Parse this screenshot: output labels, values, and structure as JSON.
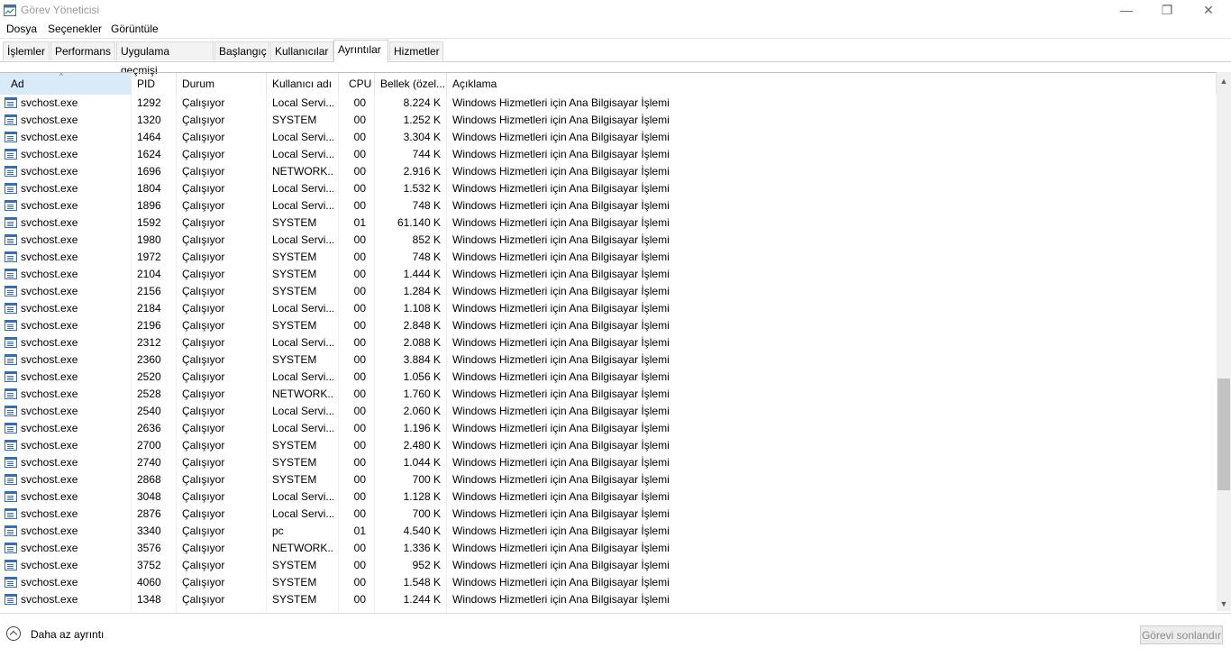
{
  "window": {
    "title": "Görev Yöneticisi",
    "minimize_glyph": "—",
    "maximize_glyph": "❐",
    "close_glyph": "✕"
  },
  "menu": [
    "Dosya",
    "Seçenekler",
    "Görüntüle"
  ],
  "tabs": [
    "İşlemler",
    "Performans",
    "Uygulama geçmişi",
    "Başlangıç",
    "Kullanıcılar",
    "Ayrıntılar",
    "Hizmetler"
  ],
  "active_tab": "Ayrıntılar",
  "columns": {
    "name": "Ad",
    "pid": "PID",
    "status": "Durum",
    "user": "Kullanıcı adı",
    "cpu": "CPU",
    "memory": "Bellek (özel...",
    "description": "Açıklama"
  },
  "sorted_column": "name",
  "sort_glyph": "^",
  "rows": [
    {
      "name": "svchost.exe",
      "pid": "1292",
      "status": "Çalışıyor",
      "user": "Local Servi...",
      "cpu": "00",
      "mem": "8.224 K",
      "desc": "Windows Hizmetleri için Ana Bilgisayar İşlemi"
    },
    {
      "name": "svchost.exe",
      "pid": "1320",
      "status": "Çalışıyor",
      "user": "SYSTEM",
      "cpu": "00",
      "mem": "1.252 K",
      "desc": "Windows Hizmetleri için Ana Bilgisayar İşlemi"
    },
    {
      "name": "svchost.exe",
      "pid": "1464",
      "status": "Çalışıyor",
      "user": "Local Servi...",
      "cpu": "00",
      "mem": "3.304 K",
      "desc": "Windows Hizmetleri için Ana Bilgisayar İşlemi"
    },
    {
      "name": "svchost.exe",
      "pid": "1624",
      "status": "Çalışıyor",
      "user": "Local Servi...",
      "cpu": "00",
      "mem": "744 K",
      "desc": "Windows Hizmetleri için Ana Bilgisayar İşlemi"
    },
    {
      "name": "svchost.exe",
      "pid": "1696",
      "status": "Çalışıyor",
      "user": "NETWORK...",
      "cpu": "00",
      "mem": "2.916 K",
      "desc": "Windows Hizmetleri için Ana Bilgisayar İşlemi"
    },
    {
      "name": "svchost.exe",
      "pid": "1804",
      "status": "Çalışıyor",
      "user": "Local Servi...",
      "cpu": "00",
      "mem": "1.532 K",
      "desc": "Windows Hizmetleri için Ana Bilgisayar İşlemi"
    },
    {
      "name": "svchost.exe",
      "pid": "1896",
      "status": "Çalışıyor",
      "user": "Local Servi...",
      "cpu": "00",
      "mem": "748 K",
      "desc": "Windows Hizmetleri için Ana Bilgisayar İşlemi"
    },
    {
      "name": "svchost.exe",
      "pid": "1592",
      "status": "Çalışıyor",
      "user": "SYSTEM",
      "cpu": "01",
      "mem": "61.140 K",
      "desc": "Windows Hizmetleri için Ana Bilgisayar İşlemi"
    },
    {
      "name": "svchost.exe",
      "pid": "1980",
      "status": "Çalışıyor",
      "user": "Local Servi...",
      "cpu": "00",
      "mem": "852 K",
      "desc": "Windows Hizmetleri için Ana Bilgisayar İşlemi"
    },
    {
      "name": "svchost.exe",
      "pid": "1972",
      "status": "Çalışıyor",
      "user": "SYSTEM",
      "cpu": "00",
      "mem": "748 K",
      "desc": "Windows Hizmetleri için Ana Bilgisayar İşlemi"
    },
    {
      "name": "svchost.exe",
      "pid": "2104",
      "status": "Çalışıyor",
      "user": "SYSTEM",
      "cpu": "00",
      "mem": "1.444 K",
      "desc": "Windows Hizmetleri için Ana Bilgisayar İşlemi"
    },
    {
      "name": "svchost.exe",
      "pid": "2156",
      "status": "Çalışıyor",
      "user": "SYSTEM",
      "cpu": "00",
      "mem": "1.284 K",
      "desc": "Windows Hizmetleri için Ana Bilgisayar İşlemi"
    },
    {
      "name": "svchost.exe",
      "pid": "2184",
      "status": "Çalışıyor",
      "user": "Local Servi...",
      "cpu": "00",
      "mem": "1.108 K",
      "desc": "Windows Hizmetleri için Ana Bilgisayar İşlemi"
    },
    {
      "name": "svchost.exe",
      "pid": "2196",
      "status": "Çalışıyor",
      "user": "SYSTEM",
      "cpu": "00",
      "mem": "2.848 K",
      "desc": "Windows Hizmetleri için Ana Bilgisayar İşlemi"
    },
    {
      "name": "svchost.exe",
      "pid": "2312",
      "status": "Çalışıyor",
      "user": "Local Servi...",
      "cpu": "00",
      "mem": "2.088 K",
      "desc": "Windows Hizmetleri için Ana Bilgisayar İşlemi"
    },
    {
      "name": "svchost.exe",
      "pid": "2360",
      "status": "Çalışıyor",
      "user": "SYSTEM",
      "cpu": "00",
      "mem": "3.884 K",
      "desc": "Windows Hizmetleri için Ana Bilgisayar İşlemi"
    },
    {
      "name": "svchost.exe",
      "pid": "2520",
      "status": "Çalışıyor",
      "user": "Local Servi...",
      "cpu": "00",
      "mem": "1.056 K",
      "desc": "Windows Hizmetleri için Ana Bilgisayar İşlemi"
    },
    {
      "name": "svchost.exe",
      "pid": "2528",
      "status": "Çalışıyor",
      "user": "NETWORK...",
      "cpu": "00",
      "mem": "1.760 K",
      "desc": "Windows Hizmetleri için Ana Bilgisayar İşlemi"
    },
    {
      "name": "svchost.exe",
      "pid": "2540",
      "status": "Çalışıyor",
      "user": "Local Servi...",
      "cpu": "00",
      "mem": "2.060 K",
      "desc": "Windows Hizmetleri için Ana Bilgisayar İşlemi"
    },
    {
      "name": "svchost.exe",
      "pid": "2636",
      "status": "Çalışıyor",
      "user": "Local Servi...",
      "cpu": "00",
      "mem": "1.196 K",
      "desc": "Windows Hizmetleri için Ana Bilgisayar İşlemi"
    },
    {
      "name": "svchost.exe",
      "pid": "2700",
      "status": "Çalışıyor",
      "user": "SYSTEM",
      "cpu": "00",
      "mem": "2.480 K",
      "desc": "Windows Hizmetleri için Ana Bilgisayar İşlemi"
    },
    {
      "name": "svchost.exe",
      "pid": "2740",
      "status": "Çalışıyor",
      "user": "SYSTEM",
      "cpu": "00",
      "mem": "1.044 K",
      "desc": "Windows Hizmetleri için Ana Bilgisayar İşlemi"
    },
    {
      "name": "svchost.exe",
      "pid": "2868",
      "status": "Çalışıyor",
      "user": "SYSTEM",
      "cpu": "00",
      "mem": "700 K",
      "desc": "Windows Hizmetleri için Ana Bilgisayar İşlemi"
    },
    {
      "name": "svchost.exe",
      "pid": "3048",
      "status": "Çalışıyor",
      "user": "Local Servi...",
      "cpu": "00",
      "mem": "1.128 K",
      "desc": "Windows Hizmetleri için Ana Bilgisayar İşlemi"
    },
    {
      "name": "svchost.exe",
      "pid": "2876",
      "status": "Çalışıyor",
      "user": "Local Servi...",
      "cpu": "00",
      "mem": "700 K",
      "desc": "Windows Hizmetleri için Ana Bilgisayar İşlemi"
    },
    {
      "name": "svchost.exe",
      "pid": "3340",
      "status": "Çalışıyor",
      "user": "pc",
      "cpu": "01",
      "mem": "4.540 K",
      "desc": "Windows Hizmetleri için Ana Bilgisayar İşlemi"
    },
    {
      "name": "svchost.exe",
      "pid": "3576",
      "status": "Çalışıyor",
      "user": "NETWORK...",
      "cpu": "00",
      "mem": "1.336 K",
      "desc": "Windows Hizmetleri için Ana Bilgisayar İşlemi"
    },
    {
      "name": "svchost.exe",
      "pid": "3752",
      "status": "Çalışıyor",
      "user": "SYSTEM",
      "cpu": "00",
      "mem": "952 K",
      "desc": "Windows Hizmetleri için Ana Bilgisayar İşlemi"
    },
    {
      "name": "svchost.exe",
      "pid": "4060",
      "status": "Çalışıyor",
      "user": "SYSTEM",
      "cpu": "00",
      "mem": "1.548 K",
      "desc": "Windows Hizmetleri için Ana Bilgisayar İşlemi"
    },
    {
      "name": "svchost.exe",
      "pid": "1348",
      "status": "Çalışıyor",
      "user": "SYSTEM",
      "cpu": "00",
      "mem": "1.244 K",
      "desc": "Windows Hizmetleri için Ana Bilgisayar İşlemi"
    }
  ],
  "scrollbar": {
    "up_glyph": "▲",
    "down_glyph": "▼"
  },
  "footer": {
    "fewer_details_label": "Daha az ayrıntı",
    "end_task_label": "Görevi sonlandır"
  }
}
